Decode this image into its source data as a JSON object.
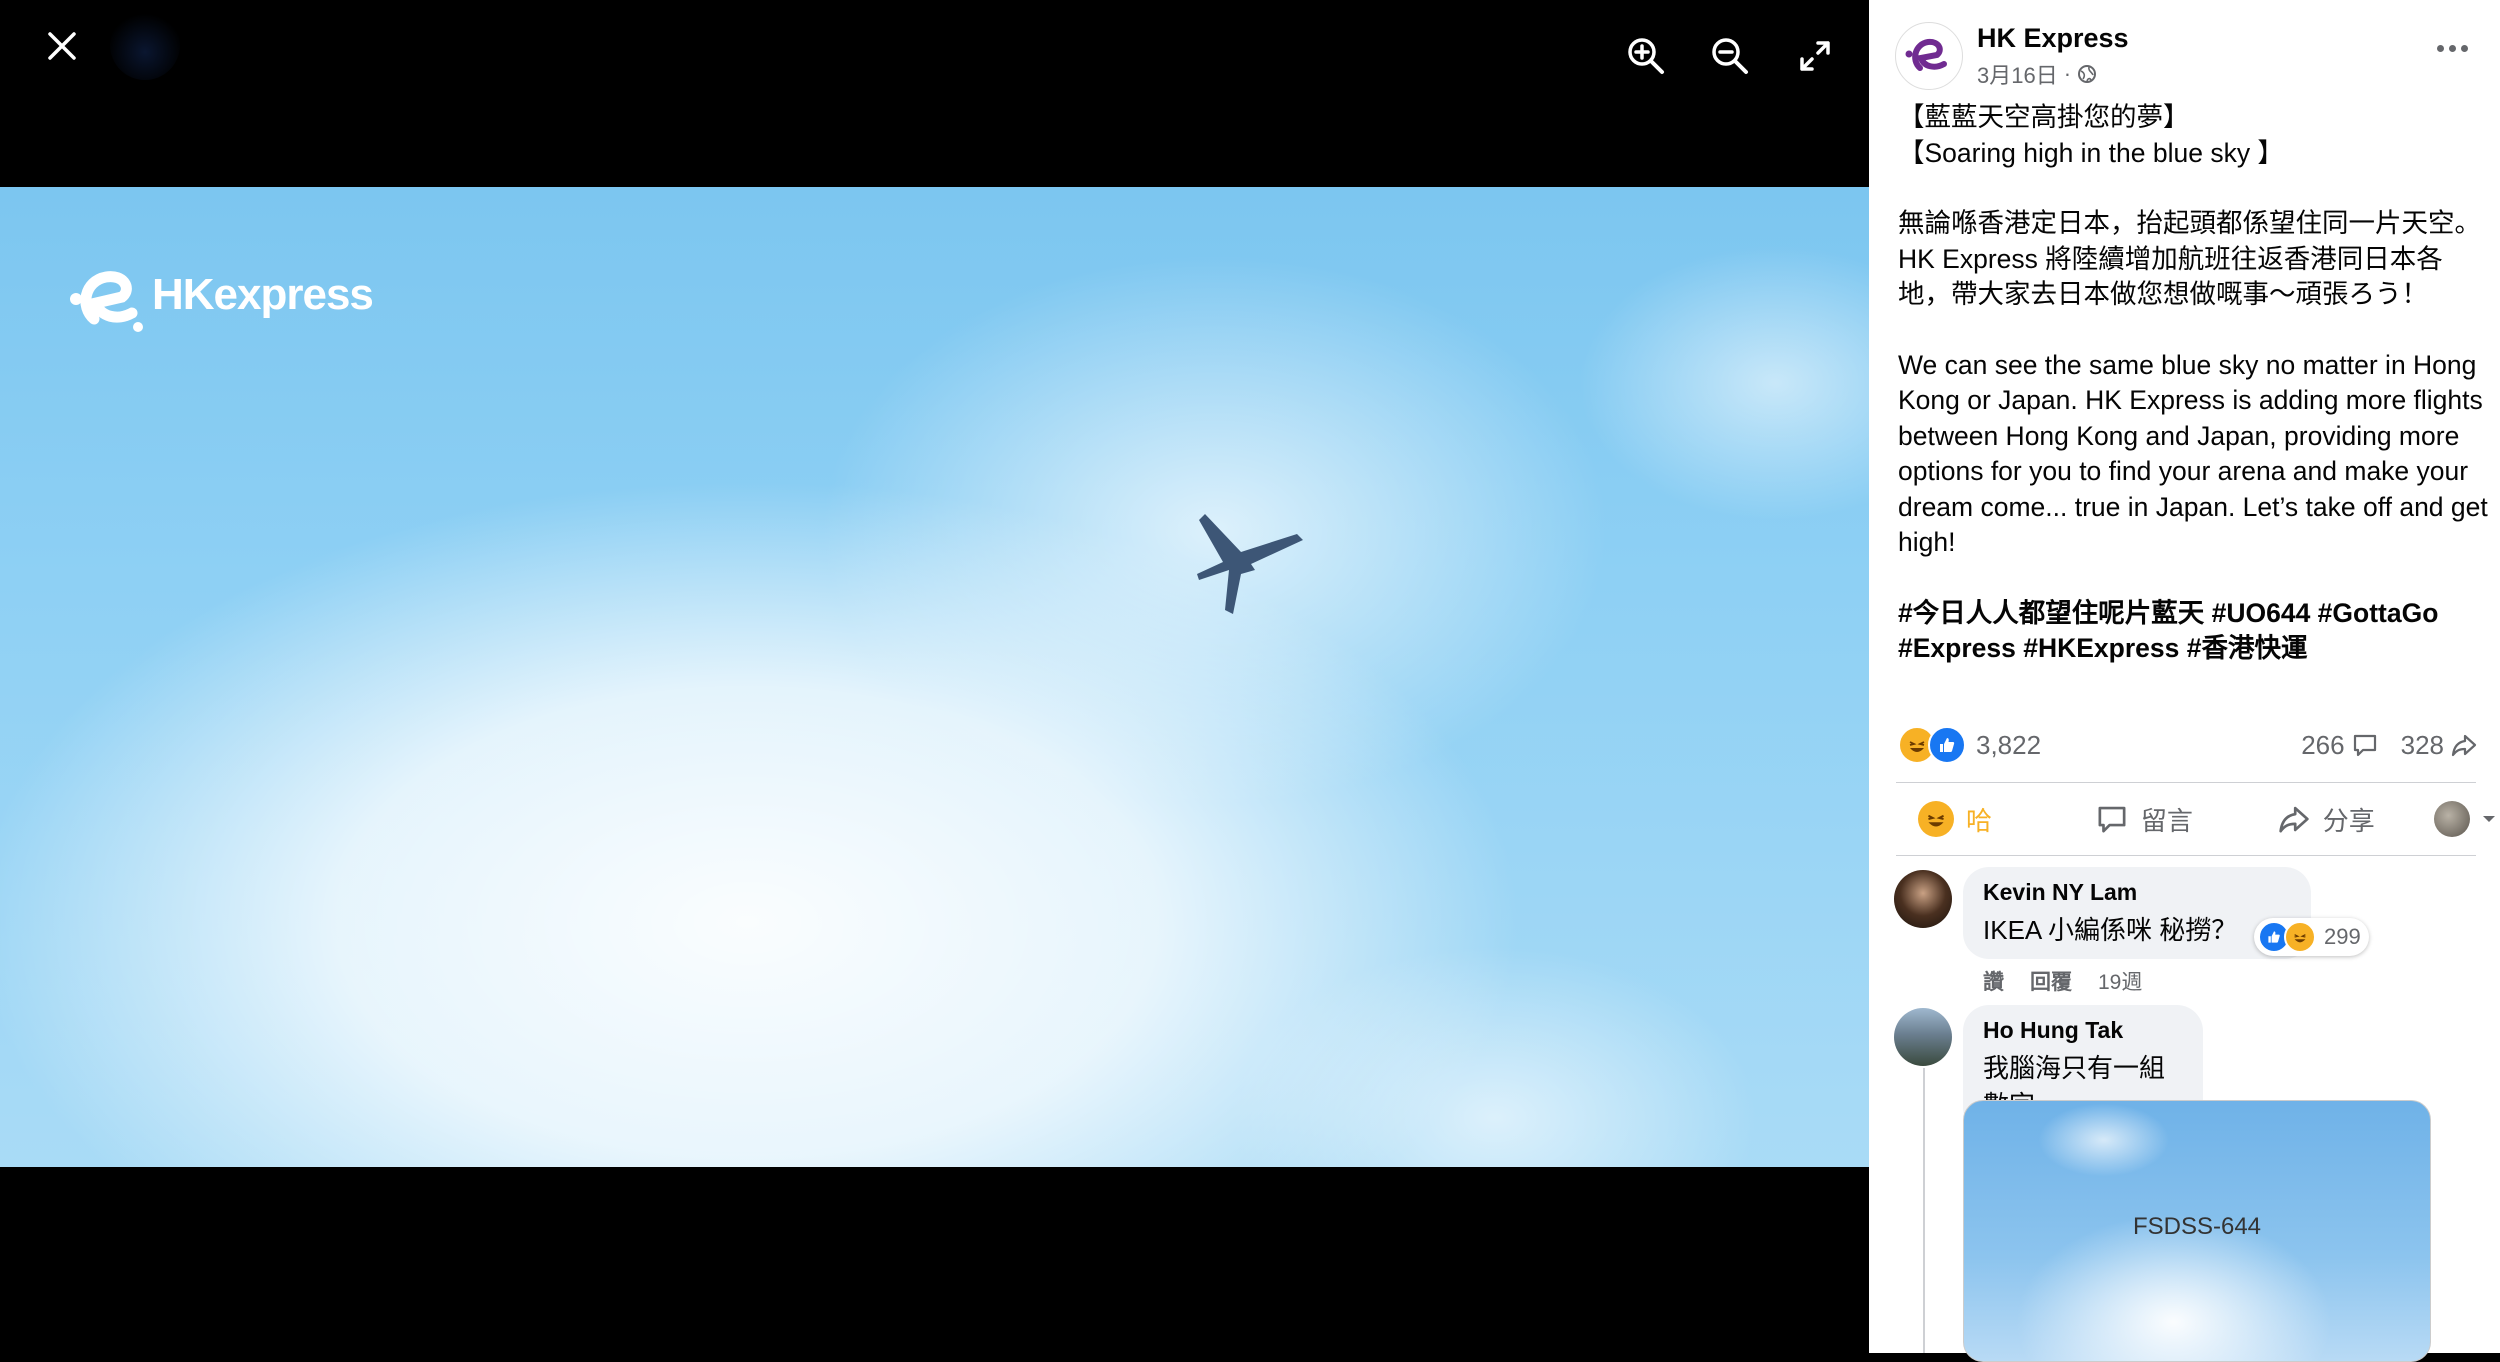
{
  "viewer": {
    "close_icon": "close-icon",
    "zoom_in_icon": "zoom-in-icon",
    "zoom_out_icon": "zoom-out-icon",
    "fullscreen_icon": "fullscreen-icon",
    "photo_logo_text": "HKexpress"
  },
  "post": {
    "page_name": "HK Express",
    "date": "3月16日",
    "separator": "·",
    "title_zh": "【藍藍天空高掛您的夢】",
    "title_en": "【Soaring high in the blue sky 】",
    "body_zh": "無論喺香港定日本，抬起頭都係望住同一片天空。HK Express 將陸續增加航班往返香港同日本各地，帶大家去日本做您想做嘅事～頑張ろう！",
    "body_en": "We can see the same blue sky no matter in Hong Kong or Japan. HK Express is adding more flights between Hong Kong and Japan, providing more options for you to find your arena and make your dream come... true in Japan. Let’s take off and get high!",
    "hashtags": "#今日人人都望住呢片藍天 #UO644 #GottaGo #Express #HKExpress #香港快運"
  },
  "stats": {
    "reactions": "3,822",
    "comments": "266",
    "shares": "328"
  },
  "actions": {
    "haha": "哈",
    "comment": "留言",
    "share": "分享"
  },
  "comments": [
    {
      "name": "Kevin NY Lam",
      "text": "IKEA 小編係咪  秘撈？",
      "react_count": "299",
      "like": "讚",
      "reply": "回覆",
      "time": "19週"
    },
    {
      "name": "Ho Hung Tak",
      "text": "我腦海只有一組數字",
      "image_caption": "FSDSS-644"
    }
  ],
  "colors": {
    "haha_yellow": "#f7b125",
    "like_blue": "#1877f2",
    "brand_purple": "#702b91"
  }
}
